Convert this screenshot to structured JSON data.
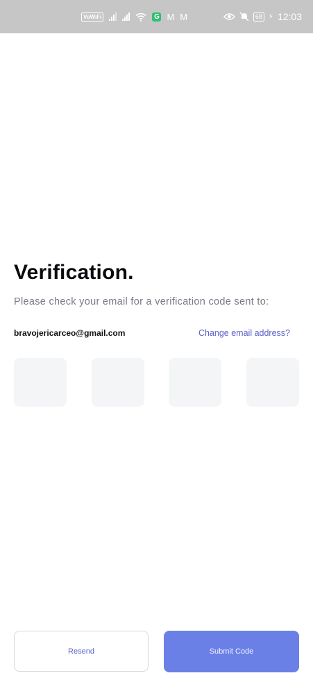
{
  "status_bar": {
    "volte_label": "VoWiFi",
    "g_badge": "G",
    "mail_icon_1": "M",
    "mail_icon_2": "M",
    "battery": "68",
    "time": "12:03"
  },
  "verification": {
    "title": "Verification.",
    "subtitle": "Please check your email for a verification code sent to:",
    "email": "bravojericarceo@gmail.com",
    "change_email_label": "Change email address?",
    "code_digits": [
      "",
      "",
      "",
      ""
    ]
  },
  "actions": {
    "resend_label": "Resend",
    "submit_label": "Submit Code"
  },
  "colors": {
    "status_bar_bg": "#c6c6c6",
    "link": "#5b5fc7",
    "primary_button": "#6b80e6",
    "code_box_bg": "#f4f5f7"
  }
}
